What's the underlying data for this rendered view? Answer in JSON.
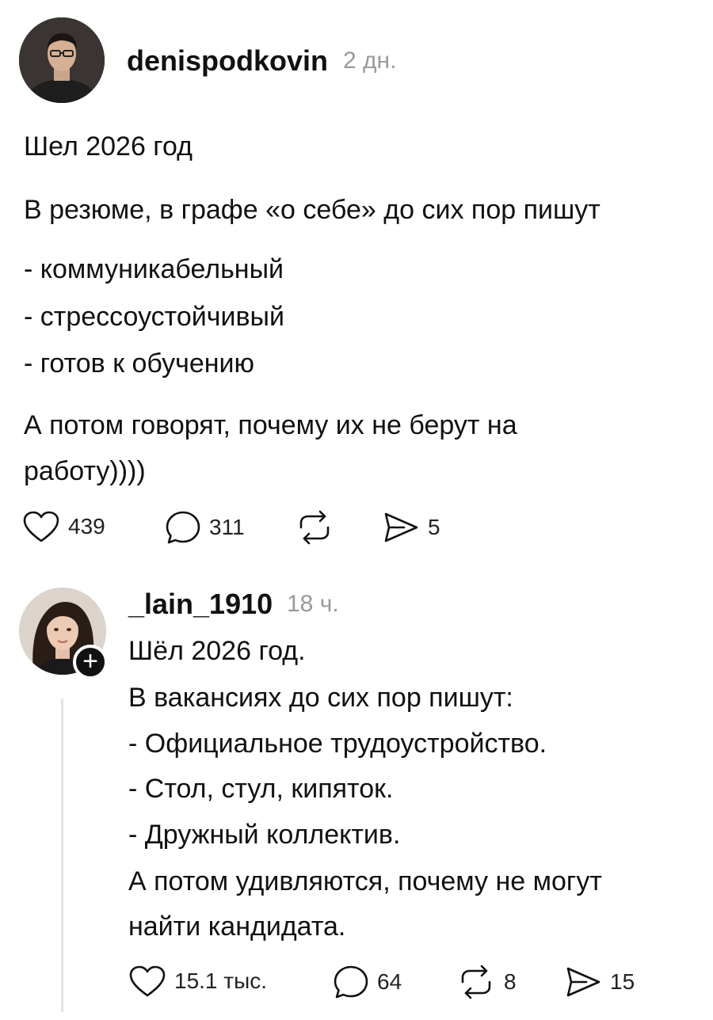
{
  "post": {
    "username": "denispodkovin",
    "time": "2 дн.",
    "paragraphs": [
      "Шел 2026 год",
      "В резюме, в графе «о себе» до сих пор пишут",
      "- коммуникабельный",
      "- стрессоустойчивый",
      "- готов к обучению",
      "А потом говорят, почему их не берут на",
      "работу))))"
    ],
    "actions": {
      "likes": "439",
      "comments": "311",
      "reposts": "",
      "shares": "5"
    }
  },
  "reply": {
    "username": "_lain_1910",
    "time": "18 ч.",
    "follow_symbol": "+",
    "lines": [
      "Шёл 2026 год.",
      "В вакансиях до сих пор пишут:",
      "- Официальное трудоустройство.",
      "- Стол, стул, кипяток.",
      "- Дружный коллектив.",
      "А потом удивляются, почему не могут",
      "найти кандидата."
    ],
    "actions": {
      "likes": "15.1 тыс.",
      "comments": "64",
      "reposts": "8",
      "shares": "15"
    }
  },
  "icons": {
    "like": "heart-icon",
    "comment": "speech-bubble-icon",
    "repost": "repost-arrows-icon",
    "share": "paper-plane-icon"
  }
}
